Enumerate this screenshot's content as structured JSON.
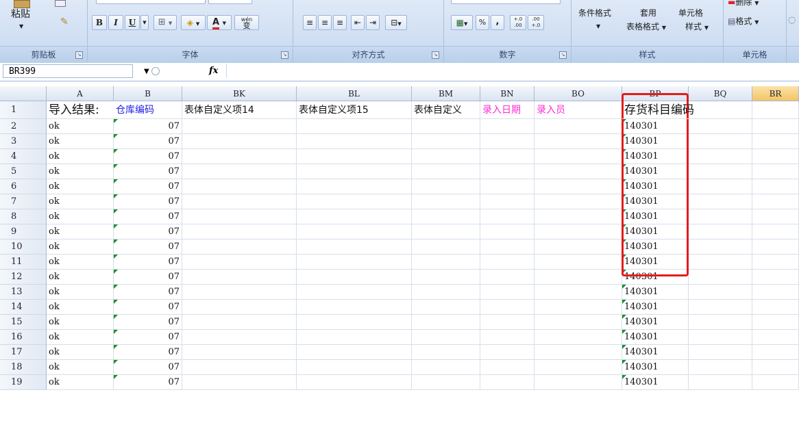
{
  "ribbon": {
    "clipboard": {
      "paste_label": "粘贴",
      "group_label": "剪贴板"
    },
    "font": {
      "bold": "B",
      "italic": "I",
      "underline": "U",
      "font_color_letter": "A",
      "wen_label": "wén",
      "wen_char": "变",
      "group_label": "字体"
    },
    "alignment": {
      "group_label": "对齐方式"
    },
    "number": {
      "percent": "%",
      "comma": ",",
      "inc_decimal": "+.0\n.00",
      "dec_decimal": ".00\n+.0",
      "group_label": "数字"
    },
    "styles": {
      "conditional": "条件格式",
      "table_format_line1": "套用",
      "table_format_line2": "表格格式",
      "cell_style_line1": "单元格",
      "cell_style_line2": "样式",
      "group_label": "样式"
    },
    "cells": {
      "delete_label": "删除",
      "format_label": "格式",
      "group_label": "单元格"
    }
  },
  "formula_bar": {
    "name_box": "BR399",
    "fx_label": "fx",
    "formula": ""
  },
  "columns": [
    "A",
    "B",
    "BK",
    "BL",
    "BM",
    "BN",
    "BO",
    "BP",
    "BQ",
    "BR"
  ],
  "header_row": {
    "A": "导入结果:",
    "B": "仓库编码",
    "BK": "表体自定义项14",
    "BL": "表体自定义项15",
    "BM": "表体自定义",
    "BN": "录入日期",
    "BO": "录入员",
    "BP": "存货科目编码"
  },
  "rows": [
    {
      "n": "1"
    },
    {
      "n": "2",
      "a": "ok",
      "b": "07",
      "bp": "140301"
    },
    {
      "n": "3",
      "a": "ok",
      "b": "07",
      "bp": "140301"
    },
    {
      "n": "4",
      "a": "ok",
      "b": "07",
      "bp": "140301"
    },
    {
      "n": "5",
      "a": "ok",
      "b": "07",
      "bp": "140301"
    },
    {
      "n": "6",
      "a": "ok",
      "b": "07",
      "bp": "140301"
    },
    {
      "n": "7",
      "a": "ok",
      "b": "07",
      "bp": "140301"
    },
    {
      "n": "8",
      "a": "ok",
      "b": "07",
      "bp": "140301"
    },
    {
      "n": "9",
      "a": "ok",
      "b": "07",
      "bp": "140301"
    },
    {
      "n": "10",
      "a": "ok",
      "b": "07",
      "bp": "140301"
    },
    {
      "n": "11",
      "a": "ok",
      "b": "07",
      "bp": "140301"
    },
    {
      "n": "12",
      "a": "ok",
      "b": "07",
      "bp": "140301"
    },
    {
      "n": "13",
      "a": "ok",
      "b": "07",
      "bp": "140301"
    },
    {
      "n": "14",
      "a": "ok",
      "b": "07",
      "bp": "140301"
    },
    {
      "n": "15",
      "a": "ok",
      "b": "07",
      "bp": "140301"
    },
    {
      "n": "16",
      "a": "ok",
      "b": "07",
      "bp": "140301"
    },
    {
      "n": "17",
      "a": "ok",
      "b": "07",
      "bp": "140301"
    },
    {
      "n": "18",
      "a": "ok",
      "b": "07",
      "bp": "140301"
    },
    {
      "n": "19",
      "a": "ok",
      "b": "07",
      "bp": "140301"
    }
  ],
  "colors": {
    "header_blue": "#1f1fe6",
    "header_magenta": "#ff2bd6",
    "highlight_red": "#e41b1b",
    "selected_col": "#f3c466"
  }
}
